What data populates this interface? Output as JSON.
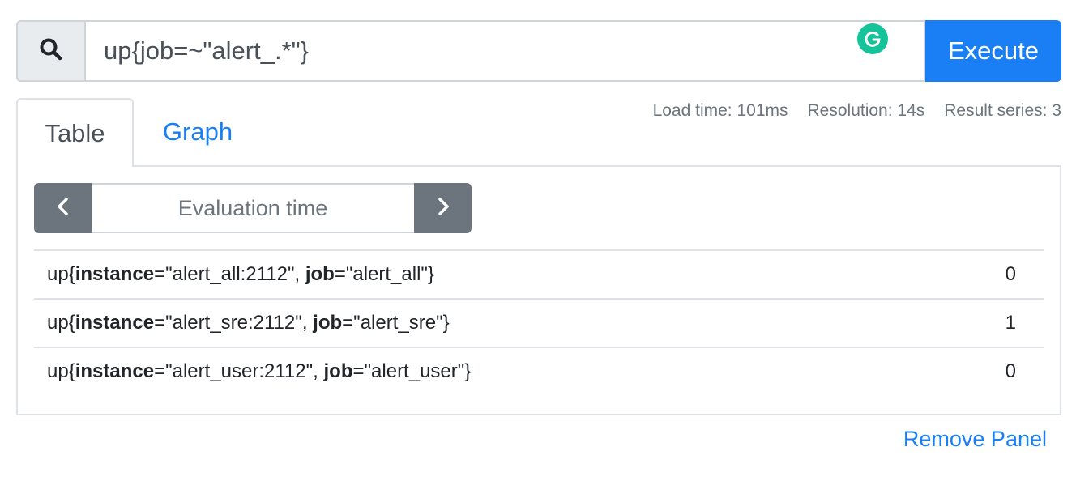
{
  "query": {
    "expression": "up{job=~\"alert_.*\"}",
    "execute_label": "Execute",
    "search_icon": "search-icon",
    "grammarly_icon": "grammarly-icon"
  },
  "tabs": [
    {
      "label": "Table",
      "active": true
    },
    {
      "label": "Graph",
      "active": false
    }
  ],
  "stats": {
    "load_time": "Load time: 101ms",
    "resolution": "Resolution: 14s",
    "result_series": "Result series: 3"
  },
  "evaluation": {
    "placeholder": "Evaluation time",
    "prev_icon": "chevron-left-icon",
    "next_icon": "chevron-right-icon"
  },
  "results": [
    {
      "metric": "up",
      "labels": [
        {
          "key": "instance",
          "value": "\"alert_all:2112\""
        },
        {
          "key": "job",
          "value": "\"alert_all\""
        }
      ],
      "value": "0"
    },
    {
      "metric": "up",
      "labels": [
        {
          "key": "instance",
          "value": "\"alert_sre:2112\""
        },
        {
          "key": "job",
          "value": "\"alert_sre\""
        }
      ],
      "value": "1"
    },
    {
      "metric": "up",
      "labels": [
        {
          "key": "instance",
          "value": "\"alert_user:2112\""
        },
        {
          "key": "job",
          "value": "\"alert_user\""
        }
      ],
      "value": "0"
    }
  ],
  "remove_panel_label": "Remove Panel",
  "colors": {
    "primary": "#1a7ff5",
    "secondary": "#6c757d",
    "grammarly": "#15c39a"
  }
}
